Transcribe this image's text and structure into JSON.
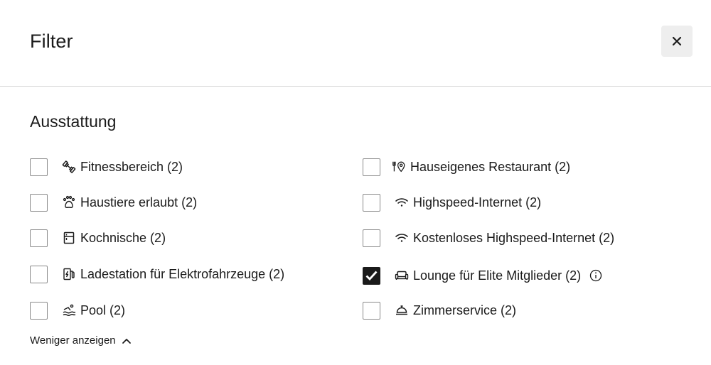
{
  "dialog": {
    "title": "Filter",
    "close_label": "×"
  },
  "section": {
    "title": "Ausstattung"
  },
  "options_left": [
    {
      "label": "Fitnessbereich (2)",
      "icon": "dumbbell-icon",
      "checked": false
    },
    {
      "label": "Haustiere erlaubt (2)",
      "icon": "paw-icon",
      "checked": false
    },
    {
      "label": "Kochnische (2)",
      "icon": "kitchenette-icon",
      "checked": false
    },
    {
      "label": "Ladestation für Elektrofahrzeuge (2)",
      "icon": "ev-charging-icon",
      "checked": false
    },
    {
      "label": "Pool (2)",
      "icon": "pool-icon",
      "checked": false
    }
  ],
  "options_right": [
    {
      "label": "Hauseigenes Restaurant (2)",
      "icon": "restaurant-icon",
      "checked": false
    },
    {
      "label": "Highspeed-Internet (2)",
      "icon": "wifi-icon",
      "checked": false
    },
    {
      "label": "Kostenloses Highspeed-Internet (2)",
      "icon": "wifi-icon",
      "checked": false
    },
    {
      "label": "Lounge für Elite Mitglieder (2)",
      "icon": "lounge-sofa-icon",
      "checked": true,
      "info": true
    },
    {
      "label": "Zimmerservice (2)",
      "icon": "room-service-bell-icon",
      "checked": false
    }
  ],
  "show_less": {
    "label": "Weniger anzeigen"
  },
  "colors": {
    "text": "#1a1a1a",
    "checkbox_border": "#8a8a8a",
    "checked_fill": "#1a1a1a",
    "close_bg": "#eeeeee",
    "divider": "#d9d9d9"
  }
}
